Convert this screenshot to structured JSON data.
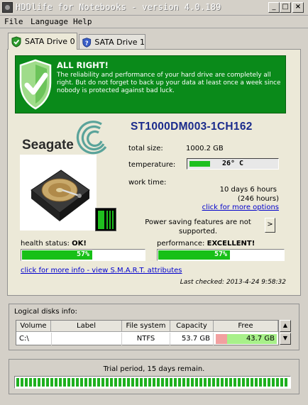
{
  "window": {
    "title": "HDDlife for Notebooks - version 4.0.189",
    "menu": [
      "File",
      "Language",
      "Help"
    ]
  },
  "tabs": [
    {
      "label": "SATA Drive 0",
      "active": true
    },
    {
      "label": "SATA Drive 1",
      "active": false
    }
  ],
  "status": {
    "title": "ALL RIGHT!",
    "message": "The reliability and performance of your hard drive are completely all right. But do not forget to back up your data at least once a week since nobody is protected against bad luck.",
    "color": "#0a8a1a"
  },
  "drive": {
    "brand": "Seagate",
    "model": "ST1000DM003-1CH162",
    "total_size_label": "total size:",
    "total_size": "1000.2 GB",
    "temperature_label": "temperature:",
    "temperature": "26° C",
    "temperature_level": 0.23,
    "work_time_label": "work time:",
    "work_time": "10 days 6 hours",
    "work_time_hours": "(246 hours)",
    "more_options_link": "click for more options",
    "power_saving": "Power saving features are not supported.",
    "power_button": ">",
    "health_label": "health status:",
    "health_value": "OK!",
    "health_percent": "57%",
    "health_level": 0.57,
    "performance_label": "performance:",
    "performance_value": "EXCELLENT!",
    "performance_percent": "57%",
    "performance_level": 0.57,
    "smart_link": "click for more info - view S.M.A.R.T. attributes",
    "last_checked": "Last checked:  2013-4-24 9:58:32"
  },
  "logical_disks": {
    "title": "Logical disks info:",
    "columns": [
      "Volume",
      "Label",
      "File system",
      "Capacity",
      "Free"
    ],
    "rows": [
      {
        "volume": "C:\\",
        "label": "",
        "file_system": "NTFS",
        "capacity": "53.7 GB",
        "free": "43.7 GB",
        "free_level": 0.81
      }
    ]
  },
  "trial": {
    "text": "Trial period, 15 days remain.",
    "level": 1.0,
    "color": "#1fb01f"
  }
}
